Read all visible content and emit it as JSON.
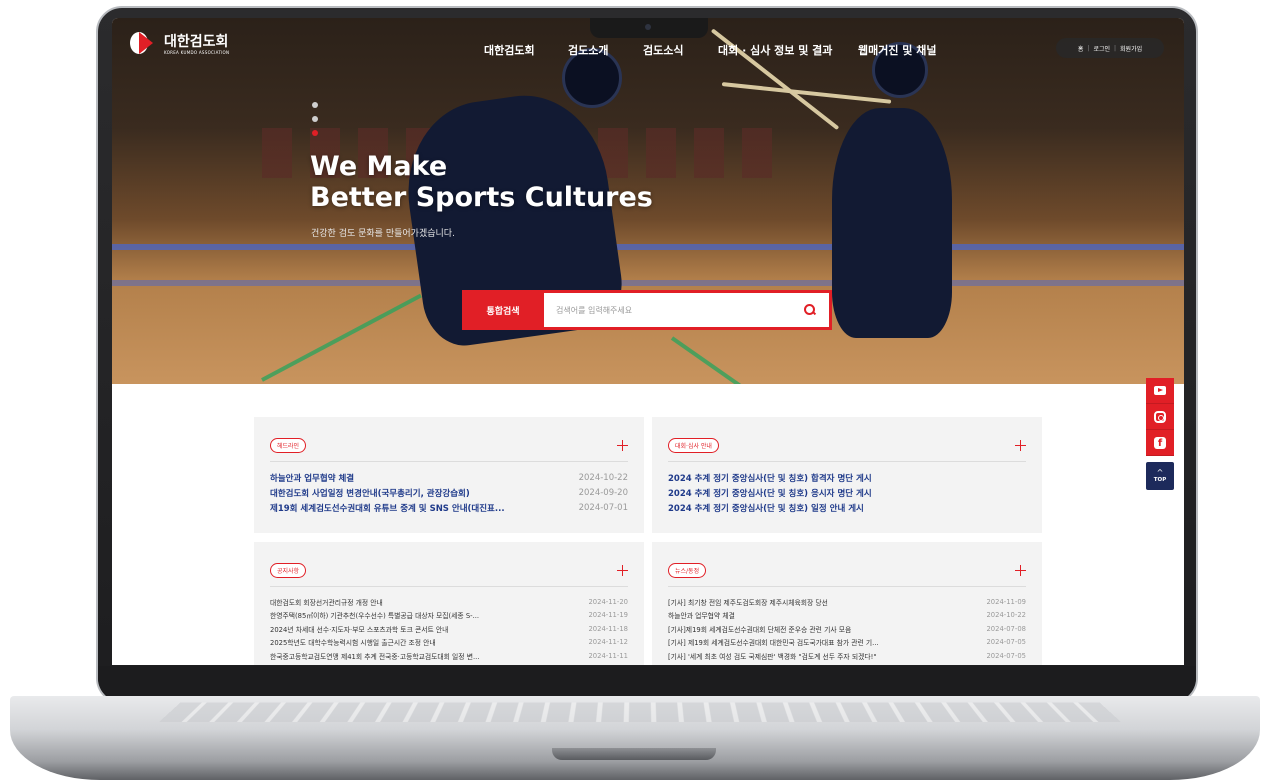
{
  "site": {
    "logo_ko": "대한검도회",
    "logo_en": "KOREA KUMDO ASSOCIATION"
  },
  "nav": {
    "items": [
      {
        "label": "대한검도회"
      },
      {
        "label": "검도소개"
      },
      {
        "label": "검도소식"
      },
      {
        "label": "대회 · 심사 정보 및 결과"
      },
      {
        "label": "웹매거진 및 채널"
      }
    ]
  },
  "util": {
    "home": "홈",
    "login": "로그인",
    "join": "회원가입"
  },
  "hero": {
    "headline_1": "We Make",
    "headline_2": "Better Sports Cultures",
    "subline": "건강한 검도 문화를 만들어가겠습니다.",
    "slide_count": 3,
    "active_slide": 3
  },
  "search": {
    "label": "통합검색",
    "placeholder": "검색어를 입력해주세요"
  },
  "boards": {
    "headline": {
      "title": "헤드라인",
      "rows": [
        {
          "title": "하늘안과 업무협약 체결",
          "date": "2024-10-22"
        },
        {
          "title": "대한검도회 사업일정 변경안내(국무총리기, 관장강습회)",
          "date": "2024-09-20"
        },
        {
          "title": "제19회 세계검도선수권대회 유튜브 중계 및 SNS 안내(대진표...",
          "date": "2024-07-01"
        }
      ]
    },
    "exam": {
      "title": "대회·심사 안내",
      "rows": [
        {
          "title": "2024 추계 정기 중앙심사(단 및 칭호) 합격자 명단 게시",
          "date": ""
        },
        {
          "title": "2024 추계 정기 중앙심사(단 및 칭호) 응시자 명단 게시",
          "date": ""
        },
        {
          "title": "2024 추계 정기 중앙심사(단 및 칭호) 일정 안내 게시",
          "date": ""
        }
      ]
    },
    "notice": {
      "title": "공지사항",
      "rows": [
        {
          "title": "대한검도회 회장선거관리규정 개정 안내",
          "date": "2024-11-20"
        },
        {
          "title": "한영주택(85㎡이하) 기관추천(우수선수) 특별공급 대상자 모집(세종 S-...",
          "date": "2024-11-19"
        },
        {
          "title": "2024년 차세대 선수·지도자·부모 스포츠과학 토크 콘서트 안내",
          "date": "2024-11-18"
        },
        {
          "title": "2025학년도 대학수학능력시험 시행일 출근시간 조정 안내",
          "date": "2024-11-12"
        },
        {
          "title": "한국중고등학교검도연맹 제41회 추계 전국중·고등학교검도대회 일정 변...",
          "date": "2024-11-11"
        }
      ]
    },
    "news": {
      "title": "뉴스/동정",
      "rows": [
        {
          "title": "[기사] 최기창 전임 제주도검도회장 제주시체육회장 당선",
          "date": "2024-11-09"
        },
        {
          "title": "하늘안과 업무협약 체결",
          "date": "2024-10-22"
        },
        {
          "title": "[기사]제19회 세계검도선수권대회 단체전 준우승 관련 기사 모음",
          "date": "2024-07-08"
        },
        {
          "title": "[기사] 제19회 세계검도선수권대회 대한민국 검도국가대표 참가 관련 기...",
          "date": "2024-07-05"
        },
        {
          "title": "[기사] '세계 최초 여성 검도 국제심판' 백경화 \"검도계 선두 주자 되겠다!\"",
          "date": "2024-07-05"
        }
      ]
    }
  },
  "quick": {
    "top_label": "TOP",
    "top_arrow": "^",
    "facebook_glyph": "f"
  },
  "colors": {
    "accent": "#e11f26",
    "headline_link": "#1f3a8a",
    "top_button": "#1d2a5b"
  }
}
